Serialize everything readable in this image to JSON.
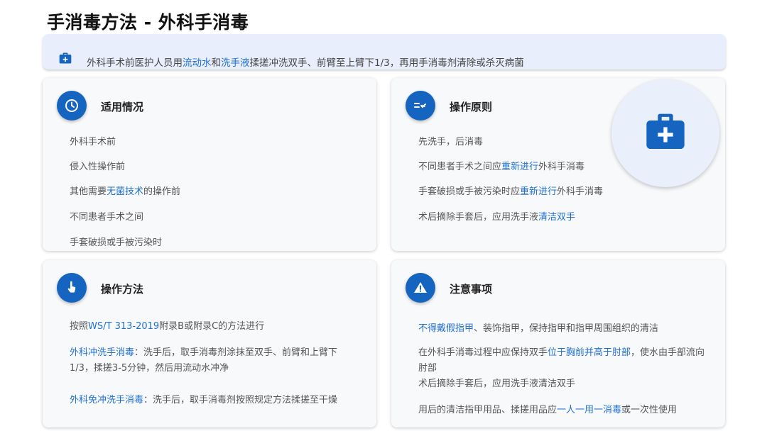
{
  "title": "手消毒方法 - 外科手消毒",
  "banner": {
    "icon": "first-aid-kit-icon",
    "pre": "外科手术前医护人员用",
    "hl1": "流动水",
    "mid1": "和",
    "hl2": "洗手液",
    "post": "揉搓冲洗双手、前臂至上臂下1/3，再用手消毒剂清除或杀灭病菌"
  },
  "cards": {
    "applicable": {
      "icon": "clock-icon",
      "title": "适用情况",
      "items": {
        "i0": "外科手术前",
        "i1": "侵入性操作前",
        "i2_pre": "其他需要",
        "i2_hl": "无菌技术",
        "i2_post": "的操作前",
        "i3": "不同患者手术之间",
        "i4": "手套破损或手被污染时"
      }
    },
    "principles": {
      "icon": "principles-icon",
      "title": "操作原则",
      "items": {
        "i0": "先洗手，后消毒",
        "i1_pre": "不同患者手术之间应",
        "i1_hl": "重新进行",
        "i1_post": "外科手消毒",
        "i2_pre": "手套破损或手被污染时应",
        "i2_hl": "重新进行",
        "i2_post": "外科手消毒",
        "i3_pre": "术后摘除手套后，应用洗手液",
        "i3_hl": "清洁双手"
      }
    },
    "method": {
      "icon": "hand-pointer-icon",
      "title": "操作方法",
      "items": {
        "i0_pre": "按照",
        "i0_hl": "WS/T 313-2019",
        "i0_post": "附录B或附录C的方法进行",
        "i1_hl": "外科冲洗手消毒",
        "i1_post": "：洗手后，取手消毒剂涂抹至双手、前臂和上臂下1/3，揉搓3-5分钟，然后用流动水冲净",
        "i2_hl": "外科免冲洗手消毒",
        "i2_post": "：洗手后，取手消毒剂按照规定方法揉搓至干燥"
      }
    },
    "notes": {
      "icon": "warning-icon",
      "title": "注意事项",
      "items": {
        "i0_hl": "不得戴假指甲",
        "i0_post": "、装饰指甲，保持指甲和指甲周围组织的清洁",
        "i1_pre": "在外科手消毒过程中应保持双手",
        "i1_hl": "位于胸前并高于肘部",
        "i1_post": "，使水由手部流向肘部",
        "i2": "术后摘除手套后，应用洗手液清洁双手",
        "i3_pre": "用后的清洁指甲用品、揉搓用品应",
        "i3_hl": "一人一用一消毒",
        "i3_post": "或一次性使用"
      }
    }
  },
  "decor": {
    "icon": "medical-kit-icon"
  },
  "colors": {
    "accent": "#1565c0",
    "highlight": "#1f6fd1",
    "banner_bg": "#e8eefc",
    "card_bg": "#f8f9fb"
  }
}
